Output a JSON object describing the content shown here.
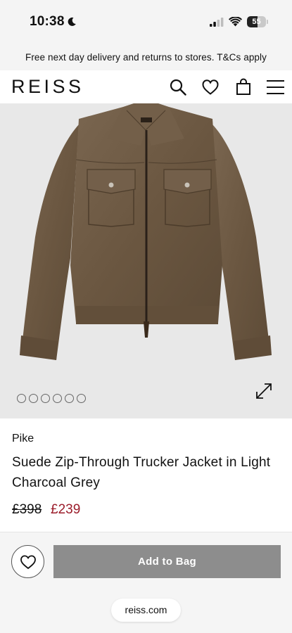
{
  "status_bar": {
    "time": "10:38",
    "battery_level": "55",
    "battery_fraction": 0.55
  },
  "promo": {
    "text": "Free next day delivery and returns to stores. T&Cs apply"
  },
  "header": {
    "logo": "REISS"
  },
  "hero": {
    "image_count": 6,
    "label_text": "REISS"
  },
  "product": {
    "brand": "Pike",
    "title": "Suede Zip-Through Trucker Jacket in Light Charcoal Grey",
    "price_old": "£398",
    "price_new": "£239"
  },
  "bottom": {
    "add_to_bag_label": "Add to Bag"
  },
  "browser": {
    "url": "reiss.com"
  },
  "colors": {
    "sale_price": "#9b1c2a",
    "add_button": "#8d8d8d",
    "hero_bg": "#e8e8e8",
    "jacket": "#6e5a43"
  },
  "icons": [
    "moon-icon",
    "signal-icon",
    "wifi-icon",
    "search-icon",
    "heart-icon",
    "bag-icon",
    "menu-icon",
    "expand-icon"
  ]
}
